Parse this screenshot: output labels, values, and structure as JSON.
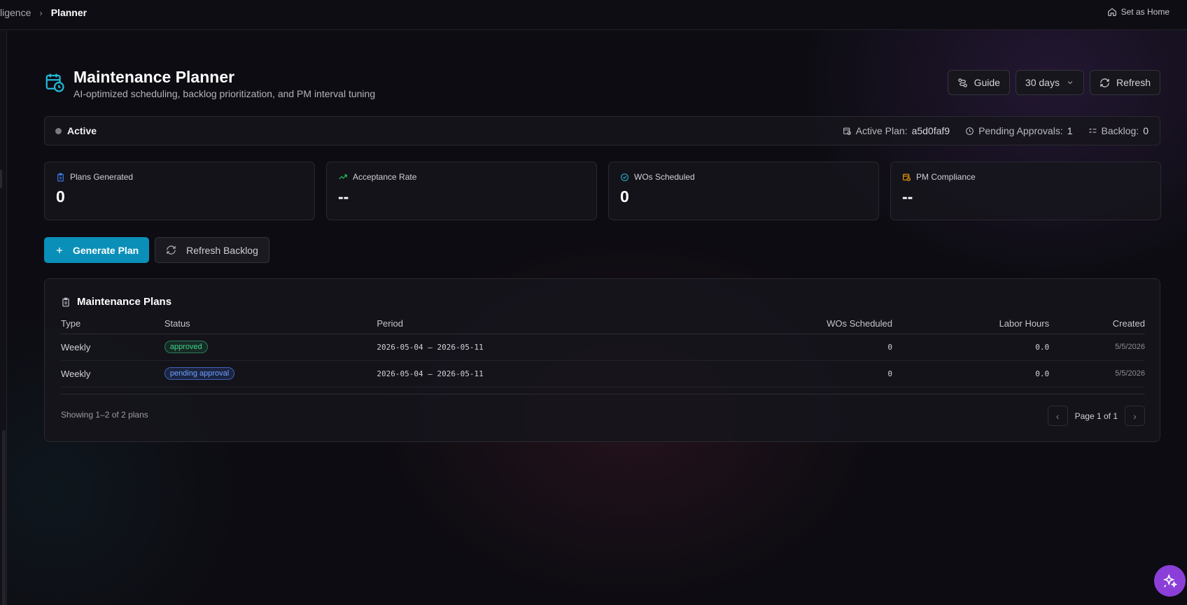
{
  "breadcrumb": {
    "prev": "ligence",
    "current": "Planner"
  },
  "topbar": {
    "set_home_label": "Set as Home"
  },
  "header": {
    "title": "Maintenance Planner",
    "subtitle": "AI-optimized scheduling, backlog prioritization, and PM interval tuning",
    "guide_label": "Guide",
    "range_value": "30 days",
    "refresh_label": "Refresh"
  },
  "status": {
    "state": "Active",
    "active_plan_label": "Active Plan:",
    "active_plan_value": "a5d0faf9",
    "pending_label": "Pending Approvals:",
    "pending_value": "1",
    "backlog_label": "Backlog:",
    "backlog_value": "0"
  },
  "cards": [
    {
      "label": "Plans Generated",
      "value": "0",
      "icon": "clipboard-icon",
      "color": "#3b82f6"
    },
    {
      "label": "Acceptance Rate",
      "value": "--",
      "icon": "trending-up-icon",
      "color": "#22c55e"
    },
    {
      "label": "WOs Scheduled",
      "value": "0",
      "icon": "check-circle-icon",
      "color": "#22b8d8"
    },
    {
      "label": "PM Compliance",
      "value": "--",
      "icon": "calendar-clock-icon",
      "color": "#f59e0b"
    }
  ],
  "actions": {
    "generate_label": "Generate Plan",
    "refresh_backlog_label": "Refresh Backlog"
  },
  "plans": {
    "title": "Maintenance Plans",
    "columns": [
      "Type",
      "Status",
      "Period",
      "WOs Scheduled",
      "Labor Hours",
      "Created"
    ],
    "rows": [
      {
        "type": "Weekly",
        "status": "approved",
        "period": "2026-05-04 — 2026-05-11",
        "wos": "0",
        "hours": "0.0",
        "created": "5/5/2026"
      },
      {
        "type": "Weekly",
        "status": "pending approval",
        "period": "2026-05-04 — 2026-05-11",
        "wos": "0",
        "hours": "0.0",
        "created": "5/5/2026"
      }
    ],
    "showing": "Showing 1–2 of 2 plans",
    "page": "Page 1 of 1"
  },
  "colors": {
    "accent": "#0a8fb8",
    "fab": "#8b3fd8"
  }
}
